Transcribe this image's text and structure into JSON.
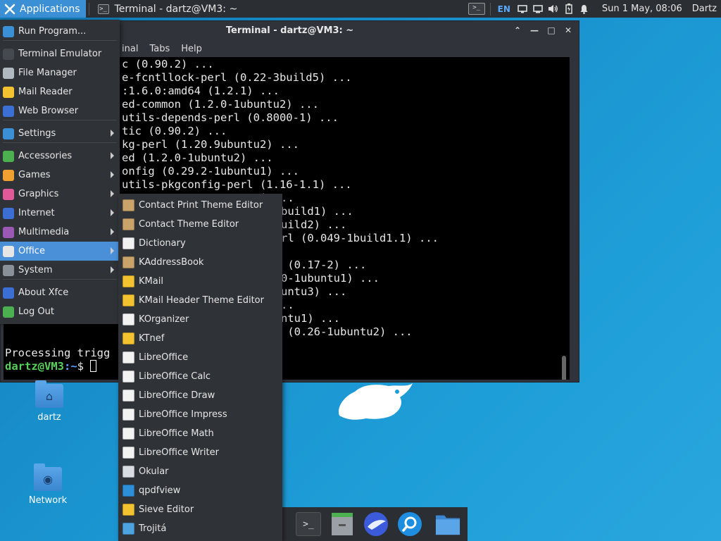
{
  "top_panel": {
    "applications_label": "Applications",
    "task_title": "Terminal - dartz@VM3: ~",
    "lang": "EN",
    "clock": "Sun  1 May, 08:06",
    "user": "Dartz"
  },
  "terminal": {
    "title": "Terminal - dartz@VM3: ~",
    "menu": [
      "inal",
      "Tabs",
      "Help"
    ],
    "lines": [
      "c (0.90.2) ...",
      "e-fcntllock-perl (0.22-3build5) ...",
      ":1.6.0:amd64 (1.2.1) ...",
      "ed-common (1.2.0-1ubuntu2) ...",
      "utils-depends-perl (0.8000-1) ...",
      "tic (0.90.2) ...",
      "kg-perl (1.20.9ubuntu2) ...",
      "ed (1.2.0-1ubuntu2) ...",
      "onfig (0.29.2-1ubuntu1) ...",
      "utils-pkgconfig-perl (1.16-1.1) ...",
      ") ...",
      "3-1build1) ...",
      "-2build2) ...",
      "-perl (0.049-1build1.1) ...",
      "",
      "eme (0.17-2) ...",
      "36.0-1ubuntu1) ...",
      "0ubuntu3) ...",
      ") ...",
      "ubuntu1) ...",
      "ils (0.26-1ubuntu2) ..."
    ],
    "processing": "Processing trigg",
    "prompt_user": "dartz@VM3",
    "prompt_path": ":~",
    "prompt_symbol": "$ "
  },
  "desktop": {
    "icons": [
      {
        "label": "dartz",
        "icon": "home-folder-icon"
      },
      {
        "label": "Network",
        "icon": "network-folder-icon"
      }
    ]
  },
  "app_menu": {
    "items": [
      {
        "label": "Run Program...",
        "icon": "run-icon",
        "color": "#3b8fd4"
      },
      {
        "label": "Terminal Emulator",
        "icon": "terminal-icon",
        "color": "#444a50"
      },
      {
        "label": "File Manager",
        "icon": "file-manager-icon",
        "color": "#b0b8c0"
      },
      {
        "label": "Mail Reader",
        "icon": "mail-icon",
        "color": "#f2c230"
      },
      {
        "label": "Web Browser",
        "icon": "web-browser-icon",
        "color": "#3b6fd4"
      },
      {
        "label": "Settings",
        "icon": "settings-icon",
        "color": "#3b8fd4"
      },
      {
        "label": "Accessories",
        "icon": "accessories-icon",
        "color": "#4caf50"
      },
      {
        "label": "Games",
        "icon": "games-icon",
        "color": "#f0a030"
      },
      {
        "label": "Graphics",
        "icon": "graphics-icon",
        "color": "#e05a9a"
      },
      {
        "label": "Internet",
        "icon": "internet-icon",
        "color": "#3b6fd4"
      },
      {
        "label": "Multimedia",
        "icon": "multimedia-icon",
        "color": "#9b59b6"
      },
      {
        "label": "Office",
        "icon": "office-icon",
        "color": "#e6e6e6"
      },
      {
        "label": "System",
        "icon": "system-icon",
        "color": "#8a9098"
      },
      {
        "label": "About Xfce",
        "icon": "about-xfce-icon",
        "color": "#3b6fd4"
      },
      {
        "label": "Log Out",
        "icon": "logout-icon",
        "color": "#4caf50"
      }
    ]
  },
  "office_menu": {
    "items": [
      {
        "label": "Contact Print Theme Editor",
        "icon": "contacts-icon",
        "color": "#c9a36a"
      },
      {
        "label": "Contact Theme Editor",
        "icon": "contacts-icon",
        "color": "#c9a36a"
      },
      {
        "label": "Dictionary",
        "icon": "dictionary-icon",
        "color": "#f2f2f2"
      },
      {
        "label": "KAddressBook",
        "icon": "addressbook-icon",
        "color": "#c9a36a"
      },
      {
        "label": "KMail",
        "icon": "kmail-icon",
        "color": "#f2c230"
      },
      {
        "label": "KMail Header Theme Editor",
        "icon": "kmail-icon",
        "color": "#f2c230"
      },
      {
        "label": "KOrganizer",
        "icon": "calendar-icon",
        "color": "#f2f2f2"
      },
      {
        "label": "KTnef",
        "icon": "ktnef-icon",
        "color": "#f2c230"
      },
      {
        "label": "LibreOffice",
        "icon": "libreoffice-icon",
        "color": "#f2f2f2"
      },
      {
        "label": "LibreOffice Calc",
        "icon": "calc-icon",
        "color": "#f2f2f2"
      },
      {
        "label": "LibreOffice Draw",
        "icon": "draw-icon",
        "color": "#f2f2f2"
      },
      {
        "label": "LibreOffice Impress",
        "icon": "impress-icon",
        "color": "#f2f2f2"
      },
      {
        "label": "LibreOffice Math",
        "icon": "math-icon",
        "color": "#f2f2f2"
      },
      {
        "label": "LibreOffice Writer",
        "icon": "writer-icon",
        "color": "#f2f2f2"
      },
      {
        "label": "Okular",
        "icon": "okular-icon",
        "color": "#d8dde3"
      },
      {
        "label": "qpdfview",
        "icon": "qpdfview-icon",
        "color": "#2c8fd8"
      },
      {
        "label": "Sieve Editor",
        "icon": "sieve-icon",
        "color": "#f2c230"
      },
      {
        "label": "Trojitá",
        "icon": "trojita-icon",
        "color": "#4ca3e0"
      }
    ]
  },
  "dock": {
    "items": [
      {
        "icon": "terminal-icon"
      },
      {
        "icon": "file-manager-icon"
      },
      {
        "icon": "web-browser-icon"
      },
      {
        "icon": "search-icon"
      },
      {
        "icon": "folder-icon"
      }
    ]
  }
}
